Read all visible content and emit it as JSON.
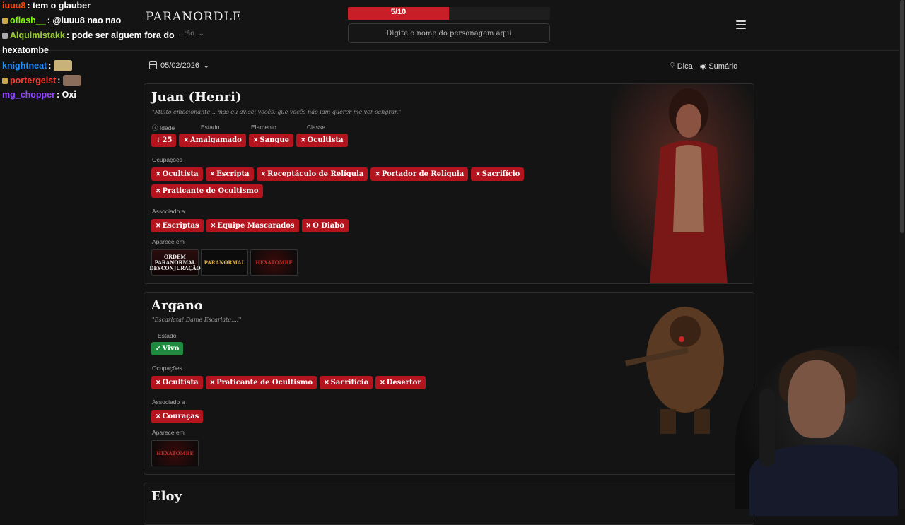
{
  "chat": [
    {
      "user": "iuuu8",
      "color": "#ff4500",
      "message": "tem o glauber"
    },
    {
      "user": "oflash__",
      "color": "#7cfc00",
      "message": "@iuuu8 nao nao"
    },
    {
      "user": "Alquimistakk",
      "color": "#9acd32",
      "message": "pode ser alguem fora do"
    },
    {
      "user": "",
      "color": "#ffffff",
      "message": "hexatombe"
    },
    {
      "user": "knightneat",
      "color": "#1e90ff",
      "message": ""
    },
    {
      "user": "portergeist",
      "color": "#ff3b30",
      "message": ""
    },
    {
      "user": "mg_chopper",
      "color": "#9146ff",
      "message": "Oxi"
    }
  ],
  "header": {
    "logo": "PARANORDLE",
    "mode": "...rão",
    "progress_text": "5/10",
    "progress_fraction": 0.5,
    "search_placeholder": "Digite o nome do personagem aqui"
  },
  "toolbar": {
    "date": "05/02/2026",
    "hint": "Dica",
    "summary": "Sumário"
  },
  "guesses": [
    {
      "name": "Juan (Henri)",
      "quote": "\"Muito emocionante... mas eu avisei vocês, que vocês não iam querer me ver sangrar.\"",
      "attr_labels": [
        "Idade",
        "Estado",
        "Elemento",
        "Classe"
      ],
      "attrs": [
        "25",
        "Amalgamado",
        "Sangue",
        "Ocultista"
      ],
      "occupations_label": "Ocupações",
      "occupations": [
        "Ocultista",
        "Escripta",
        "Receptáculo de Relíquia",
        "Portador de Relíquia",
        "Sacrifício",
        "Praticante de Ocultismo"
      ],
      "associated_label": "Associado a",
      "associated": [
        "Escriptas",
        "Equipe Mascarados",
        "O Diabo"
      ],
      "appears_label": "Aparece em",
      "appears": [
        "ORDEM PARANORMAL DESCONJURAÇÃO",
        "PARANORMAL",
        "HEXATOMBE"
      ]
    },
    {
      "name": "Argano",
      "quote": "\"Escarlata! Dame Escarlata...!\"",
      "attr_labels": [
        "Estado"
      ],
      "attrs": [
        "Vivo"
      ],
      "occupations_label": "Ocupações",
      "occupations": [
        "Ocultista",
        "Praticante de Ocultismo",
        "Sacrifício",
        "Desertor"
      ],
      "associated_label": "Associado a",
      "associated": [
        "Couraças"
      ],
      "appears_label": "Aparece em",
      "appears": [
        "HEXATOMBE"
      ]
    },
    {
      "name": "Eloy"
    }
  ],
  "colors": {
    "wrong": "#b3141e",
    "correct": "#1f8a3f",
    "accent": "#c81e28"
  }
}
